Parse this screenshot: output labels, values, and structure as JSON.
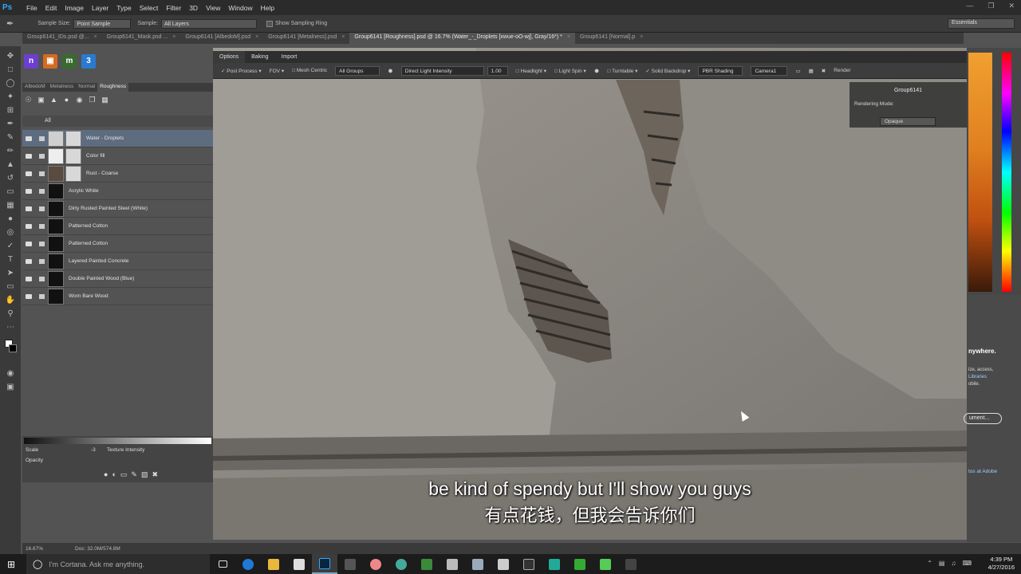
{
  "menubar": {
    "logo": "Ps",
    "items": [
      "File",
      "Edit",
      "Image",
      "Layer",
      "Type",
      "Select",
      "Filter",
      "3D",
      "View",
      "Window",
      "Help"
    ]
  },
  "options": {
    "sample_size_label": "Sample Size:",
    "sample_size_value": "Point Sample",
    "sample_label": "Sample:",
    "sample_value": "All Layers",
    "show_ring_label": "Show Sampling Ring",
    "workspace": "Essentials"
  },
  "doc_tabs": [
    {
      "label": "Group6141_IDs.psd @..."
    },
    {
      "label": "Group6141_Mask.psd ..."
    },
    {
      "label": "Group6141 [AlbedoM].psd"
    },
    {
      "label": "Group6141 [Metalness].psd"
    },
    {
      "label": "Group6141 [Roughness].psd @ 16.7% (Water_-_Droplets [xwue-oO-wj], Gray/16*) *",
      "active": true
    },
    {
      "label": "Group6141 [Normal].p"
    }
  ],
  "layer_tabs": [
    "AlbedoM",
    "Metalness",
    "Normal",
    "Roughness"
  ],
  "all_label": "All",
  "layers": [
    {
      "name": "Water - Droplets",
      "selected": true,
      "thumb": "#cfcfcf"
    },
    {
      "name": "Color fill",
      "thumb": "#eeeeee"
    },
    {
      "name": "Rust - Coarse",
      "thumb": "#5a4a40"
    },
    {
      "name": "Acrylic White",
      "thumb": "#111111"
    },
    {
      "name": "Dirty Rusted Painted Steel (White)",
      "thumb": "#111111"
    },
    {
      "name": "Patterned Cotton",
      "thumb": "#111111"
    },
    {
      "name": "Patterned Cotton",
      "thumb": "#111111"
    },
    {
      "name": "Layered Painted Concrete",
      "thumb": "#111111"
    },
    {
      "name": "Double Painted Wood (Blue)",
      "thumb": "#111111"
    },
    {
      "name": "Worn Bare Wood",
      "thumb": "#111111"
    }
  ],
  "bottom_panel": {
    "scale_label": "Scale",
    "scale_value": "-3",
    "texture_label": "Texture Intensity",
    "opacity_label": "Opacity"
  },
  "viewer": {
    "tabs": [
      "Options",
      "Baking",
      "Import"
    ],
    "post_process": "Post Process",
    "fov": "FOV",
    "mesh_centric": "Mesh Centric",
    "groups": "All Groups",
    "direct_light": "Direct Light Intensity",
    "intensity_value": "1.00",
    "headlight": "Headlight",
    "light_spin": "Light Spin",
    "turntable": "Turntable",
    "solid_backdrop": "Solid Backdrop",
    "pbr_shading": "PBR Shading",
    "camera": "Camera1",
    "render": "Render"
  },
  "group_panel": {
    "title": "Group6141",
    "rendering_mode_label": "Rendering Mode:",
    "rendering_mode_value": "Opaque"
  },
  "libraries": {
    "title": "nywhere.",
    "text": "ize, access,\nLibraries\nobile.",
    "libraries_link": "Libraries",
    "button": "ument...",
    "link": "tos at Adobe"
  },
  "status": {
    "zoom": "16.67%",
    "doc": "Doc: 32.0M/574.8M"
  },
  "subtitles": {
    "en": "be kind of spendy but I'll show you guys",
    "cn": "有点花钱，但我会告诉你们"
  },
  "taskbar": {
    "search_placeholder": "I'm Cortana. Ask me anything.",
    "time": "4:39 PM",
    "date": "4/27/2016"
  },
  "colors": {
    "accent": "#31a8ff",
    "selected_layer": "#5e6c80"
  }
}
